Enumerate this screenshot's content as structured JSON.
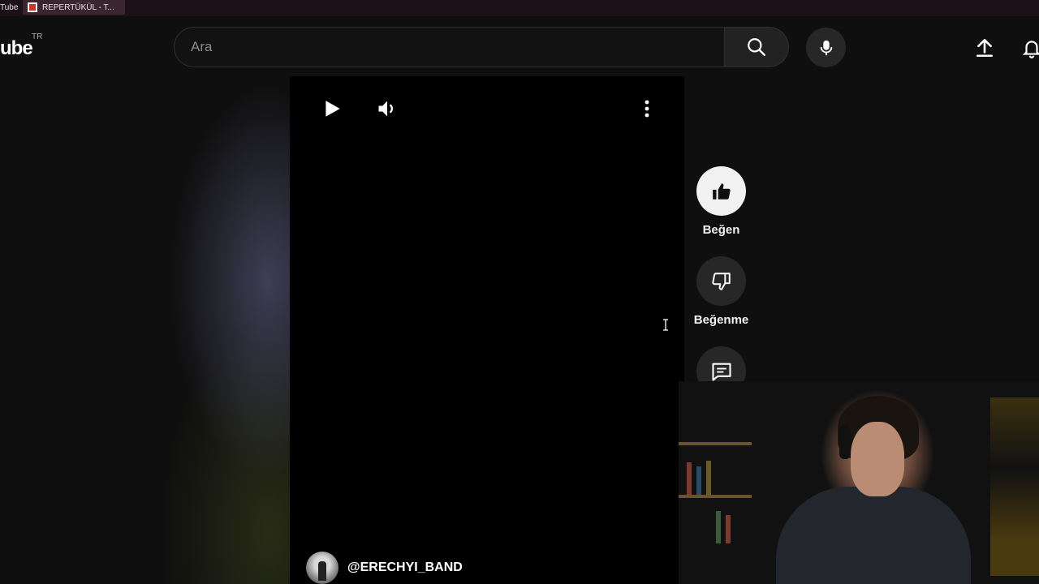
{
  "browser": {
    "tabs": [
      {
        "label": "Tube"
      },
      {
        "label": "REPERTÜKÜL - T..."
      }
    ]
  },
  "header": {
    "logo_text": "ube",
    "region_code": "TR",
    "search": {
      "placeholder": "Ara",
      "value": ""
    },
    "icons": {
      "search": "search-icon",
      "mic": "microphone-icon",
      "upload": "upload-icon",
      "notifications": "bell-icon"
    }
  },
  "player": {
    "state": "paused",
    "channel_handle": "@ERECHYI_BAND"
  },
  "actions": {
    "like_label": "Beğen",
    "dislike_label": "Beğenme",
    "comment_label": ""
  },
  "colors": {
    "background": "#0f0f0f",
    "like_active": "#f1f1f1",
    "button_bg": "#272727"
  }
}
